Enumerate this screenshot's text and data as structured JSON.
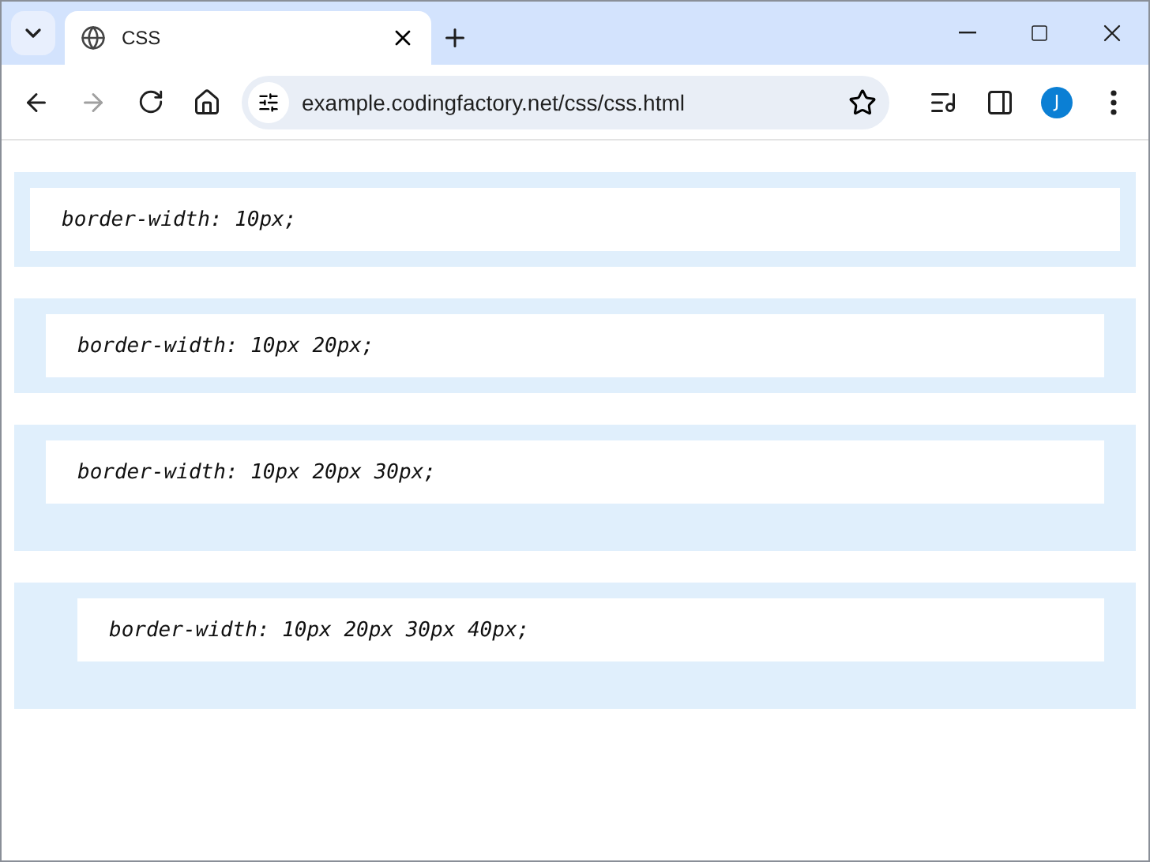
{
  "browser": {
    "tab": {
      "title": "CSS",
      "selected": true
    },
    "address": "example.codingfactory.net/css/css.html",
    "profile_initial": "J"
  },
  "examples": [
    {
      "code": "border-width: 10px;"
    },
    {
      "code": "border-width: 10px 20px;"
    },
    {
      "code": "border-width: 10px 20px 30px;"
    },
    {
      "code": "border-width: 10px 20px 30px 40px;"
    }
  ]
}
